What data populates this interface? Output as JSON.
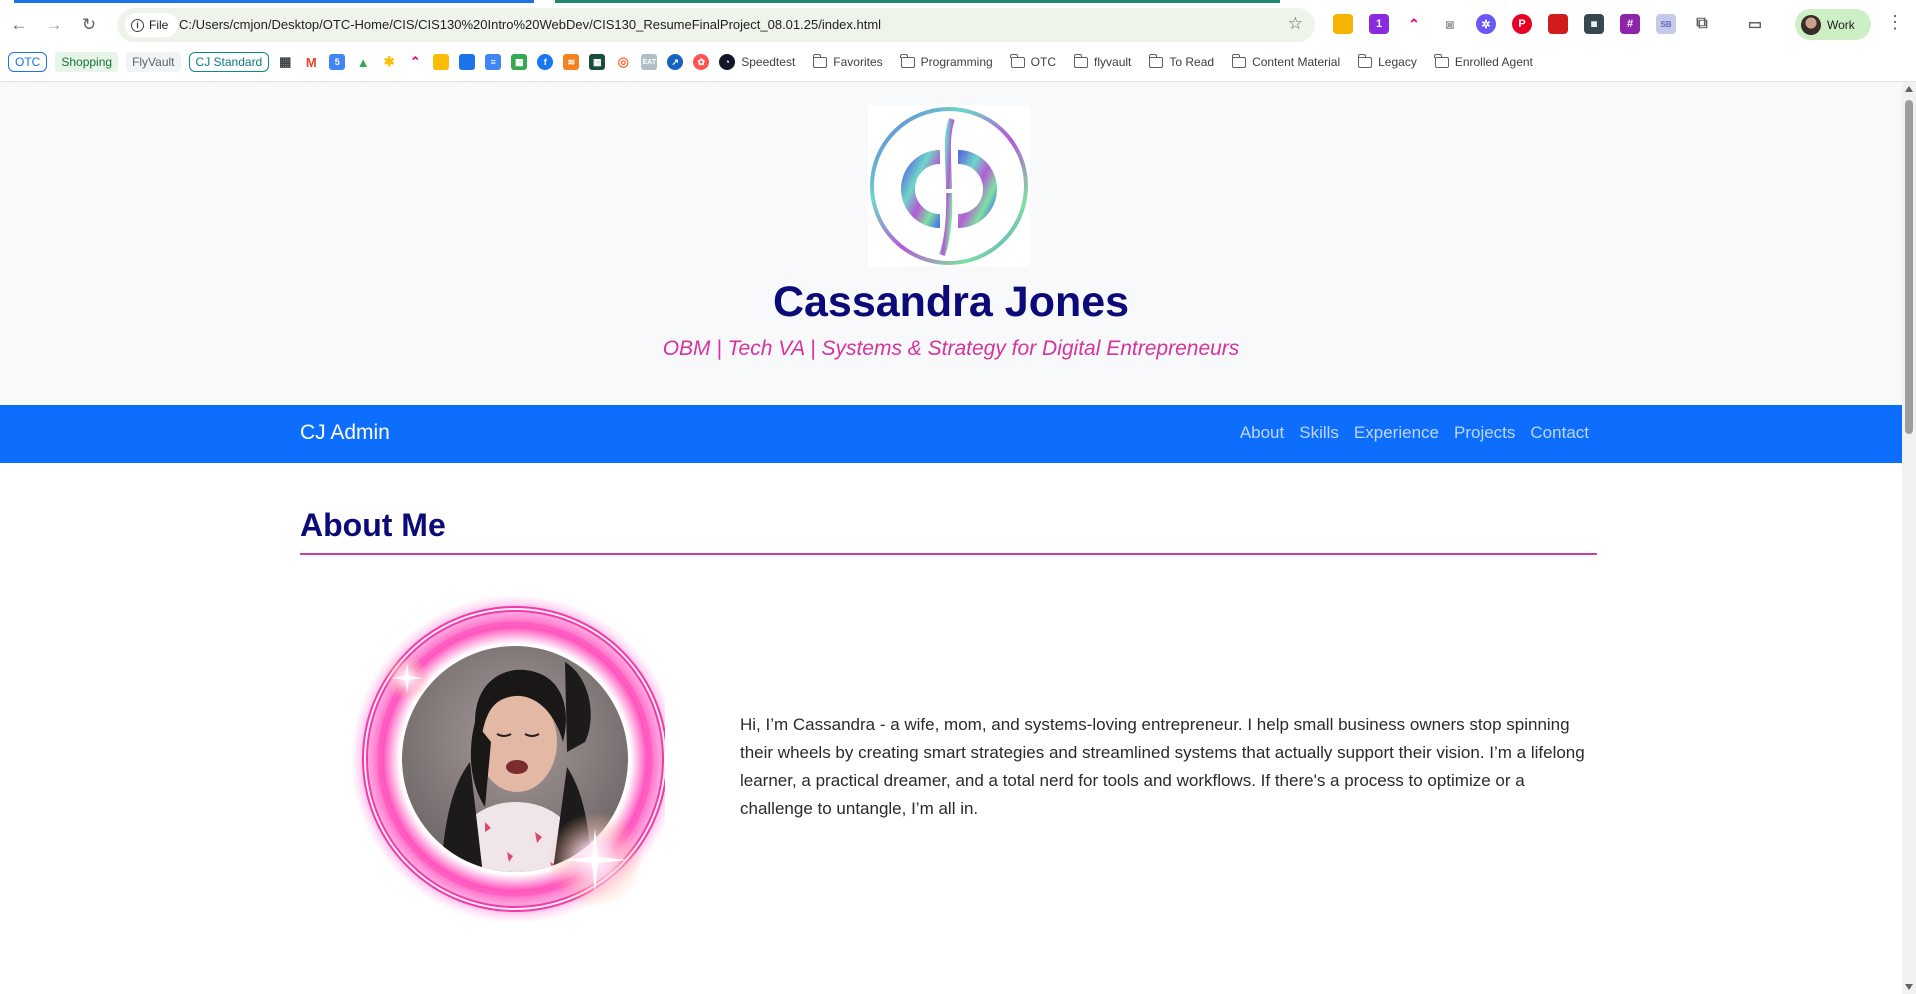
{
  "browser": {
    "site_chip_label": "File",
    "url": "C:/Users/cmjon/Desktop/OTC-Home/CIS/CIS130%20Intro%20WebDev/CIS130_ResumeFinalProject_08.01.25/index.html",
    "profile_label": "Work",
    "bookmarks": {
      "pill_otc": "OTC",
      "pill_shopping": "Shopping",
      "pill_flyvault": "FlyVault",
      "pill_cj_standard": "CJ Standard",
      "speedtest": "Speedtest",
      "folders": [
        "Favorites",
        "Programming",
        "OTC",
        "flyvault",
        "To Read",
        "Content Material",
        "Legacy",
        "Enrolled Agent"
      ]
    }
  },
  "header": {
    "name": "Cassandra Jones",
    "tagline": "OBM | Tech VA | Systems & Strategy for Digital Entrepreneurs"
  },
  "navbar": {
    "brand": "CJ Admin",
    "links": [
      "About",
      "Skills",
      "Experience",
      "Projects",
      "Contact"
    ]
  },
  "about": {
    "heading": "About Me",
    "text": "Hi, I’m Cassandra - a wife, mom, and systems-loving entrepreneur. I help small business owners stop spinning their wheels by creating smart strategies and streamlined systems that actually support their vision. I’m a lifelong learner, a practical dreamer, and a total nerd for tools and workflows. If there's a process to optimize or a challenge to untangle, I’m all in."
  },
  "colors": {
    "navbar": "#0d6efd",
    "heading": "#0b0a78",
    "accent_pink": "#d6339e",
    "page_bg": "#f8f9fa"
  }
}
